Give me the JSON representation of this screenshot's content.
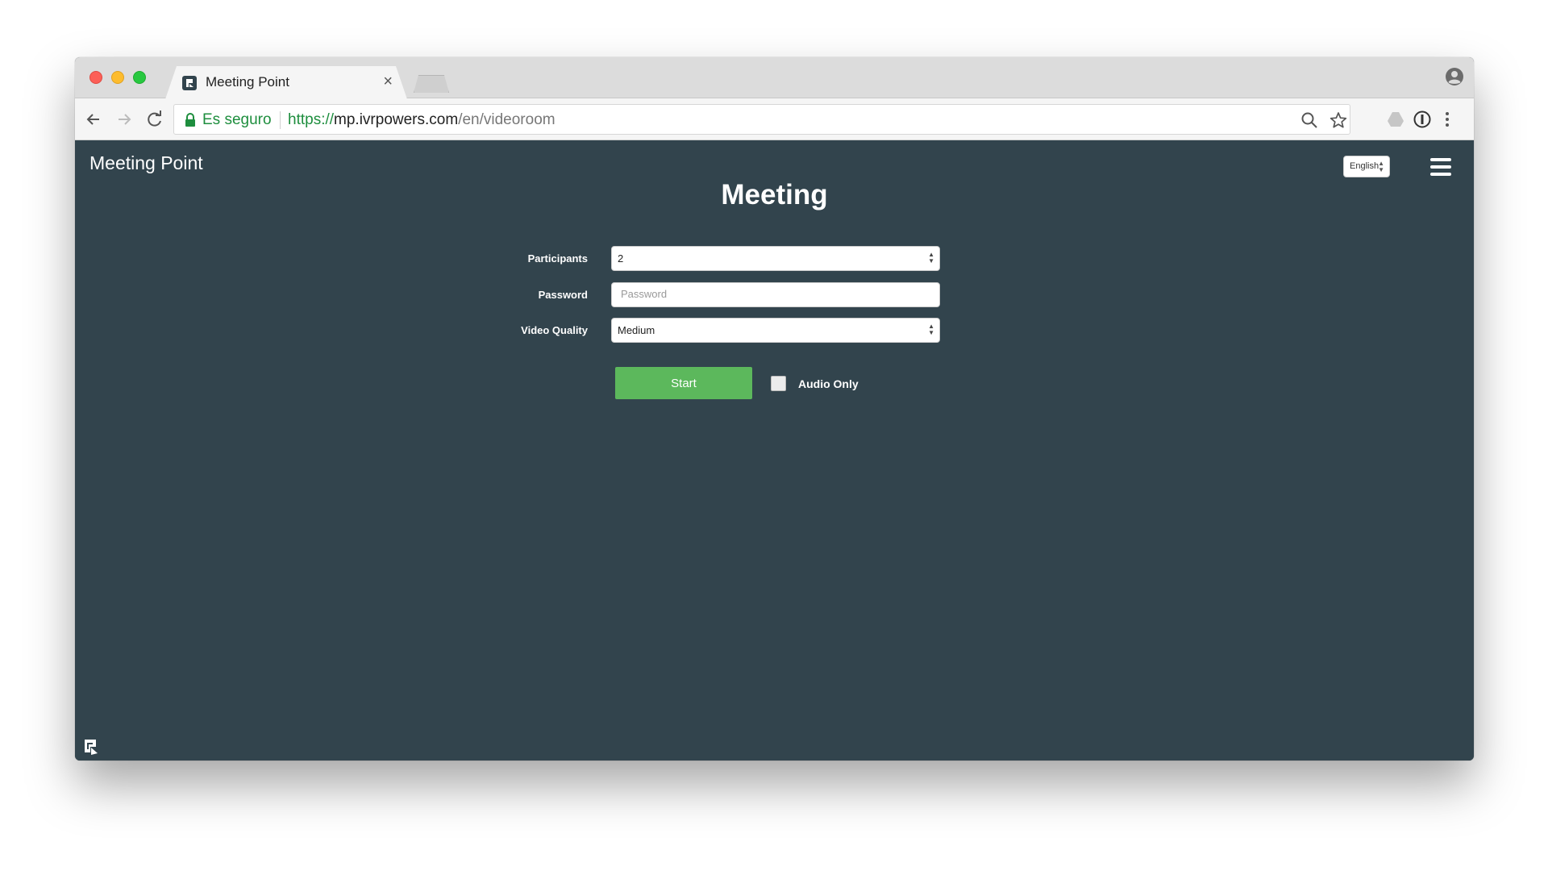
{
  "browser": {
    "tab_title": "Meeting Point",
    "tab_close": "×",
    "secure_label": "Es seguro",
    "url_scheme": "https://",
    "url_host": "mp.ivrpowers.com",
    "url_path": "/en/videoroom"
  },
  "header": {
    "brand": "Meeting Point",
    "language": "English"
  },
  "main": {
    "title": "Meeting",
    "participants": {
      "label": "Participants",
      "value": "2"
    },
    "password": {
      "label": "Password",
      "placeholder": "Password",
      "value": ""
    },
    "video_quality": {
      "label": "Video Quality",
      "value": "Medium"
    },
    "start_label": "Start",
    "audio_only": {
      "label": "Audio Only",
      "checked": false
    }
  },
  "colors": {
    "page_bg": "#32444d",
    "start_button": "#5cb85c",
    "secure_green": "#1e8e3e"
  },
  "icons": [
    "meeting-point-logo-icon",
    "close-icon",
    "user-profile-icon",
    "back-icon",
    "forward-icon",
    "reload-icon",
    "lock-icon",
    "zoom-icon",
    "star-icon",
    "drive-icon",
    "password-manager-icon",
    "more-icon",
    "hamburger-menu-icon"
  ]
}
